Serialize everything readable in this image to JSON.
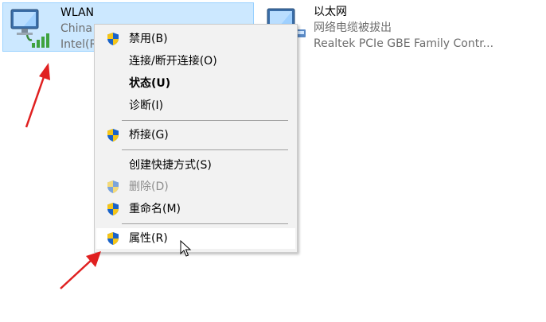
{
  "adapters": [
    {
      "name": "WLAN",
      "status": "China",
      "device": "Intel(R",
      "selected": true,
      "icon": "wifi-adapter-icon"
    },
    {
      "name": "以太网",
      "status": "网络电缆被拔出",
      "device": "Realtek PCIe GBE Family Contr...",
      "selected": false,
      "icon": "ethernet-adapter-icon"
    }
  ],
  "context_menu": {
    "items": [
      {
        "label": "禁用(B)",
        "shield": true,
        "bold": false,
        "disabled": false
      },
      {
        "label": "连接/断开连接(O)",
        "shield": false,
        "bold": false,
        "disabled": false
      },
      {
        "label": "状态(U)",
        "shield": false,
        "bold": true,
        "disabled": false
      },
      {
        "label": "诊断(I)",
        "shield": false,
        "bold": false,
        "disabled": false
      },
      {
        "label": "桥接(G)",
        "shield": true,
        "bold": false,
        "disabled": false
      },
      {
        "label": "创建快捷方式(S)",
        "shield": false,
        "bold": false,
        "disabled": false
      },
      {
        "label": "删除(D)",
        "shield": true,
        "bold": false,
        "disabled": true
      },
      {
        "label": "重命名(M)",
        "shield": true,
        "bold": false,
        "disabled": false
      },
      {
        "label": "属性(R)",
        "shield": true,
        "bold": false,
        "disabled": false,
        "hovered": true
      }
    ]
  },
  "colors": {
    "selection_bg": "#cce8ff",
    "menu_bg": "#f2f2f2",
    "annotation_arrow": "#e02020",
    "shield_blue": "#1a63c8",
    "shield_yellow": "#f5c518"
  }
}
